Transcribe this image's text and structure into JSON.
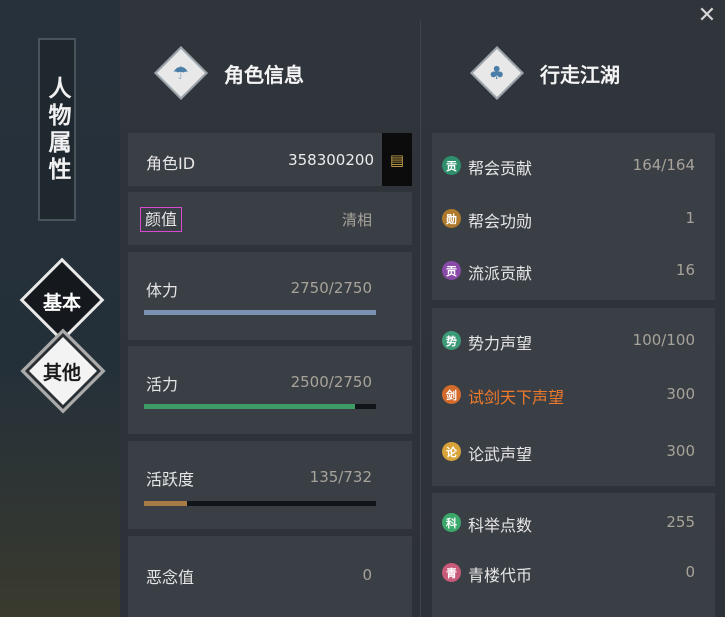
{
  "close": "✕",
  "sidebar": {
    "vertical_title": "人物属性",
    "tabs": [
      {
        "label": "基本"
      },
      {
        "label": "其他"
      }
    ]
  },
  "left": {
    "title": "角色信息",
    "role_id": {
      "label": "角色ID",
      "value": "358300200"
    },
    "appearance": {
      "label": "颜值",
      "value": "清相"
    },
    "stamina": {
      "label": "体力",
      "value": "2750/2750",
      "fill": 1.0,
      "color": "#7b93b3"
    },
    "vitality": {
      "label": "活力",
      "value": "2500/2750",
      "fill": 0.909,
      "color": "#3f9b66"
    },
    "activity": {
      "label": "活跃度",
      "value": "135/732",
      "fill": 0.184,
      "color": "#a77b46"
    },
    "malice": {
      "label": "恶念值",
      "value": "0"
    }
  },
  "right": {
    "title": "行走江湖",
    "group1": [
      {
        "icon": "贡",
        "label": "帮会贡献",
        "value": "164/164",
        "color": "#2f8f6d"
      },
      {
        "icon": "勋",
        "label": "帮会功勋",
        "value": "1",
        "color": "#b07a2e"
      },
      {
        "icon": "贡",
        "label": "流派贡献",
        "value": "16",
        "color": "#8a4aa8"
      }
    ],
    "group2": [
      {
        "icon": "势",
        "label": "势力声望",
        "value": "100/100",
        "color": "#3d9a78"
      },
      {
        "icon": "剑",
        "label": "试剑天下声望",
        "value": "300",
        "color": "#d46a2c"
      },
      {
        "icon": "论",
        "label": "论武声望",
        "value": "300",
        "color": "#d8a43a"
      }
    ],
    "group3": [
      {
        "icon": "科",
        "label": "科举点数",
        "value": "255",
        "color": "#3aa86b"
      },
      {
        "icon": "青",
        "label": "青楼代币",
        "value": "0",
        "color": "#c85a7a"
      }
    ]
  }
}
